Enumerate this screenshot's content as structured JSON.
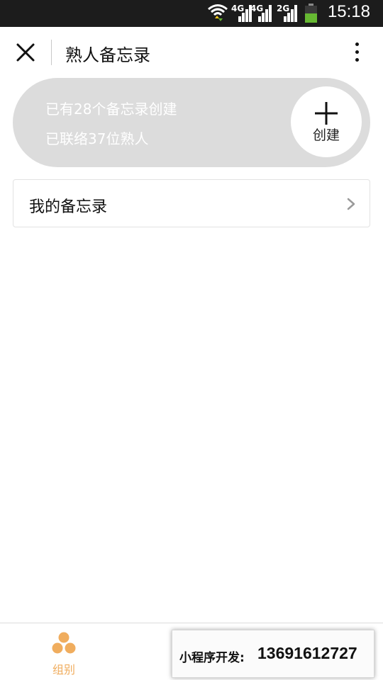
{
  "status_bar": {
    "sig1_label": "4G",
    "sig2_label": "4G",
    "sig3_label": "2G",
    "time": "15:18",
    "battery_level": 0.55,
    "battery_color": "#66b832"
  },
  "header": {
    "title": "熟人备忘录",
    "close_icon": "close-icon",
    "more_icon": "more-vertical-icon"
  },
  "summary": {
    "line1": "已有28个备忘录创建",
    "line2": "已联络37位熟人",
    "create_label": "创建",
    "create_icon": "plus-icon"
  },
  "list": {
    "items": [
      {
        "label": "我的备忘录",
        "icon": "chevron-right-icon"
      }
    ]
  },
  "tab_bar": {
    "tabs": [
      {
        "label": "组别",
        "icon": "group-dots-icon",
        "color": "#f0ad5e"
      }
    ]
  },
  "ad_banner": {
    "prefix": "小程序开发:",
    "phone": "13691612727"
  }
}
